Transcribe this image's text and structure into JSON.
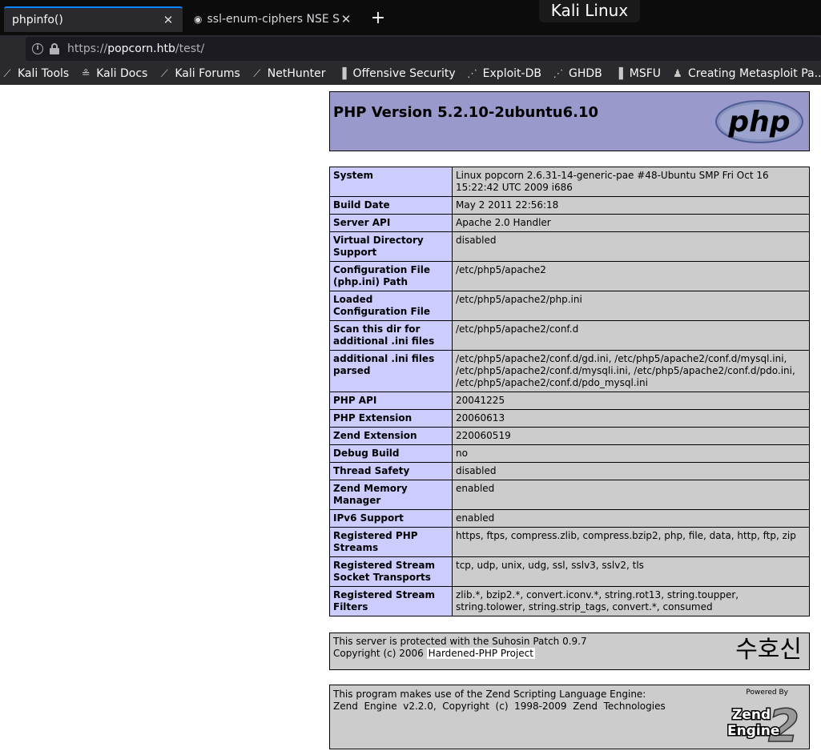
{
  "browser": {
    "tabs": [
      {
        "title": "phpinfo()",
        "active": true
      },
      {
        "title": "ssl-enum-ciphers NSE Sc",
        "active": false
      }
    ],
    "new_tab_label": "+",
    "os_title": "Kali Linux",
    "url": {
      "scheme": "https://",
      "host": "popcorn.htb",
      "path": "/test/"
    },
    "bookmarks": [
      {
        "label": "Kali Tools",
        "icon": "kali-dragon-icon"
      },
      {
        "label": "Kali Docs",
        "icon": "kali-docs-icon"
      },
      {
        "label": "Kali Forums",
        "icon": "kali-dragon-icon"
      },
      {
        "label": "NetHunter",
        "icon": "kali-dragon-icon"
      },
      {
        "label": "Offensive Security",
        "icon": "offsec-icon"
      },
      {
        "label": "Exploit-DB",
        "icon": "exploit-db-icon"
      },
      {
        "label": "GHDB",
        "icon": "ghdb-icon"
      },
      {
        "label": "MSFU",
        "icon": "msfu-icon"
      },
      {
        "label": "Creating Metasploit Pa...",
        "icon": "metasploit-icon"
      }
    ]
  },
  "page": {
    "header_title": "PHP Version 5.2.10-2ubuntu6.10",
    "logo_text": "php",
    "rows": [
      {
        "label": "System",
        "value": "Linux popcorn 2.6.31-14-generic-pae #48-Ubuntu SMP Fri Oct 16 15:22:42 UTC 2009 i686"
      },
      {
        "label": "Build Date",
        "value": "May 2 2011 22:56:18"
      },
      {
        "label": "Server API",
        "value": "Apache 2.0 Handler"
      },
      {
        "label": "Virtual Directory Support",
        "value": "disabled"
      },
      {
        "label": "Configuration File (php.ini) Path",
        "value": "/etc/php5/apache2"
      },
      {
        "label": "Loaded Configuration File",
        "value": "/etc/php5/apache2/php.ini"
      },
      {
        "label": "Scan this dir for additional .ini files",
        "value": "/etc/php5/apache2/conf.d"
      },
      {
        "label": "additional .ini files parsed",
        "value": "/etc/php5/apache2/conf.d/gd.ini, /etc/php5/apache2/conf.d/mysql.ini, /etc/php5/apache2/conf.d/mysqli.ini, /etc/php5/apache2/conf.d/pdo.ini, /etc/php5/apache2/conf.d/pdo_mysql.ini"
      },
      {
        "label": "PHP API",
        "value": "20041225"
      },
      {
        "label": "PHP Extension",
        "value": "20060613"
      },
      {
        "label": "Zend Extension",
        "value": "220060519"
      },
      {
        "label": "Debug Build",
        "value": "no"
      },
      {
        "label": "Thread Safety",
        "value": "disabled"
      },
      {
        "label": "Zend Memory Manager",
        "value": "enabled"
      },
      {
        "label": "IPv6 Support",
        "value": "enabled"
      },
      {
        "label": "Registered PHP Streams",
        "value": "https, ftps, compress.zlib, compress.bzip2, php, file, data, http, ftp, zip"
      },
      {
        "label": "Registered Stream Socket Transports",
        "value": "tcp, udp, unix, udg, ssl, sslv3, sslv2, tls"
      },
      {
        "label": "Registered Stream Filters",
        "value": "zlib.*, bzip2.*, convert.iconv.*, string.rot13, string.toupper, string.tolower, string.strip_tags, convert.*, consumed"
      }
    ],
    "suhosin": {
      "line1": "This server is protected with the Suhosin Patch 0.9.7",
      "line2_prefix": "Copyright (c) 2006 ",
      "link": "Hardened-PHP Project",
      "korean": "수호신"
    },
    "zend": {
      "line1": "This program makes use of the Zend Scripting Language Engine:",
      "line2": "Zend  Engine  v2.2.0,  Copyright  (c)  1998-2009  Zend  Technologies",
      "powered_by": "Powered By",
      "logo_line1": "Zend",
      "logo_line2": "Engine",
      "logo_number": "2"
    }
  },
  "colors": {
    "header_bg": "#9999cc",
    "label_bg": "#ccccff",
    "value_bg": "#cccccc",
    "chrome_dark": "#0c0c0d",
    "chrome": "#2a2a2e"
  }
}
